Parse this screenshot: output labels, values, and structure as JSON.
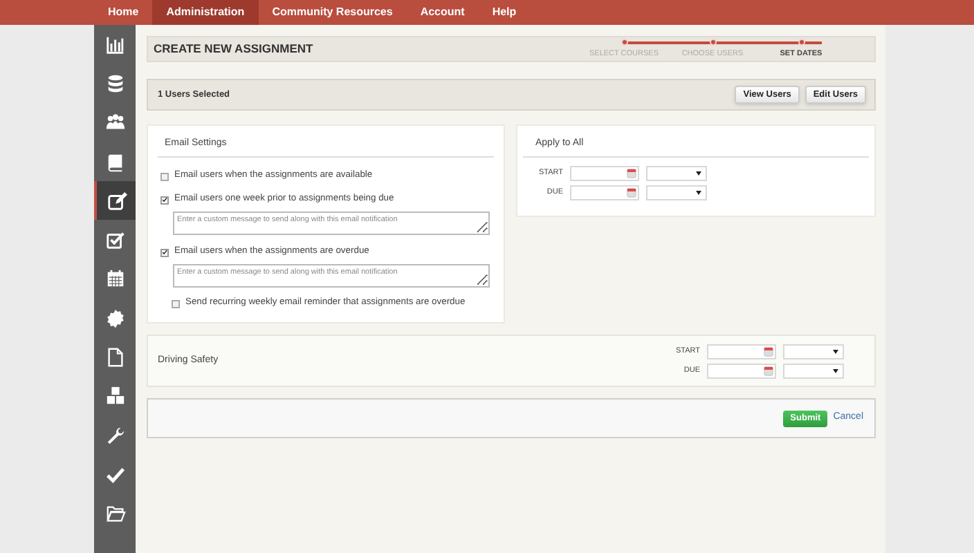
{
  "nav": [
    {
      "label": "Home",
      "selected": false
    },
    {
      "label": "Administration",
      "selected": true
    },
    {
      "label": "Community Resources",
      "selected": false
    },
    {
      "label": "Account",
      "selected": false
    },
    {
      "label": "Help",
      "selected": false
    }
  ],
  "sidebar": [
    {
      "kind": "chart",
      "selected": false
    },
    {
      "kind": "database",
      "selected": false
    },
    {
      "kind": "people",
      "selected": false
    },
    {
      "kind": "book",
      "selected": false
    },
    {
      "kind": "edit",
      "selected": true
    },
    {
      "kind": "checkbox",
      "selected": false
    },
    {
      "kind": "calendar",
      "selected": false
    },
    {
      "kind": "badge",
      "selected": false
    },
    {
      "kind": "document",
      "selected": false
    },
    {
      "kind": "cubes",
      "selected": false
    },
    {
      "kind": "wrench",
      "selected": false
    },
    {
      "kind": "check",
      "selected": false
    },
    {
      "kind": "folder",
      "selected": false
    }
  ],
  "header": {
    "title": "CREATE NEW ASSIGNMENT",
    "steps": [
      {
        "label": "SELECT COURSES",
        "selected": false
      },
      {
        "label": "CHOOSE USERS",
        "selected": false
      },
      {
        "label": "SET DATES",
        "selected": true
      }
    ]
  },
  "users_bar": {
    "text": "1 Users Selected",
    "buttons": [
      "View Users",
      "Edit Users"
    ]
  },
  "email_settings": {
    "title": "Email Settings",
    "options": [
      {
        "kind": "checkbox",
        "label": "Email users when the assignments are available",
        "checked": false
      },
      {
        "kind": "checkbox",
        "label": "Email users one week prior to assignments being due",
        "checked": true,
        "placeholder": "Enter a custom message to send along with this email notification"
      },
      {
        "kind": "checkbox",
        "label": "Email users when the assignments are overdue",
        "checked": true,
        "placeholder": "Enter a custom message to send along with this email notification"
      },
      {
        "kind": "sub_checkbox",
        "label": "Send recurring weekly email reminder that assignments are overdue",
        "checked": false
      }
    ]
  },
  "apply_to_all": {
    "title": "Apply to All",
    "rows": [
      {
        "label": "START"
      },
      {
        "label": "DUE"
      }
    ]
  },
  "courses": [
    {
      "name": "Driving Safety",
      "rows": [
        {
          "label": "START"
        },
        {
          "label": "DUE"
        }
      ]
    }
  ],
  "actions": {
    "submit": "Submit",
    "cancel": "Cancel"
  }
}
